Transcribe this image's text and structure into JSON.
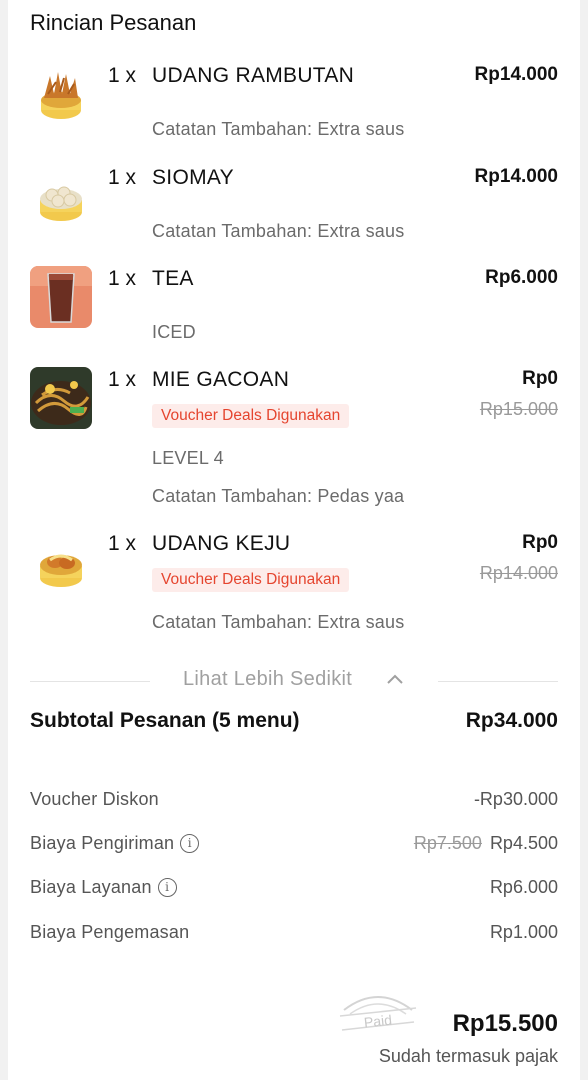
{
  "header": {
    "title": "Rincian Pesanan"
  },
  "items": [
    {
      "qty": "1 x",
      "name": "UDANG RAMBUTAN",
      "price": "Rp14.000",
      "note": "Catatan Tambahan: Extra saus",
      "icon": "fried-shrimp-icon"
    },
    {
      "qty": "1 x",
      "name": "SIOMAY",
      "price": "Rp14.000",
      "note": "Catatan Tambahan: Extra saus",
      "icon": "dumpling-icon"
    },
    {
      "qty": "1 x",
      "name": "TEA",
      "price": "Rp6.000",
      "note": "ICED",
      "icon": "iced-tea-icon"
    },
    {
      "qty": "1 x",
      "name": "MIE GACOAN",
      "price": "Rp0",
      "original_price": "Rp15.000",
      "voucher": "Voucher Deals Digunakan",
      "variant": "LEVEL 4",
      "note": "Catatan Tambahan: Pedas yaa",
      "icon": "noodle-icon"
    },
    {
      "qty": "1 x",
      "name": "UDANG KEJU",
      "price": "Rp0",
      "original_price": "Rp14.000",
      "voucher": "Voucher Deals Digunakan",
      "note": "Catatan Tambahan: Extra saus",
      "icon": "cheese-shrimp-icon"
    }
  ],
  "toggle": {
    "label": "Lihat Lebih Sedikit",
    "icon": "chevron-up-icon"
  },
  "subtotal": {
    "label": "Subtotal Pesanan (5 menu)",
    "value": "Rp34.000"
  },
  "fees": {
    "voucher": {
      "label": "Voucher Diskon",
      "value": "-Rp30.000"
    },
    "delivery": {
      "label": "Biaya Pengiriman",
      "old": "Rp7.500",
      "value": "Rp4.500",
      "icon": "info-icon"
    },
    "service": {
      "label": "Biaya Layanan",
      "value": "Rp6.000",
      "icon": "info-icon"
    },
    "packaging": {
      "label": "Biaya Pengemasan",
      "value": "Rp1.000"
    }
  },
  "total": {
    "value": "Rp15.500",
    "note": "Sudah termasuk pajak",
    "stamp": "Paid"
  },
  "colors": {
    "voucher_bg": "#fdecea",
    "voucher_text": "#e5452f",
    "muted": "#9a9a9a"
  }
}
